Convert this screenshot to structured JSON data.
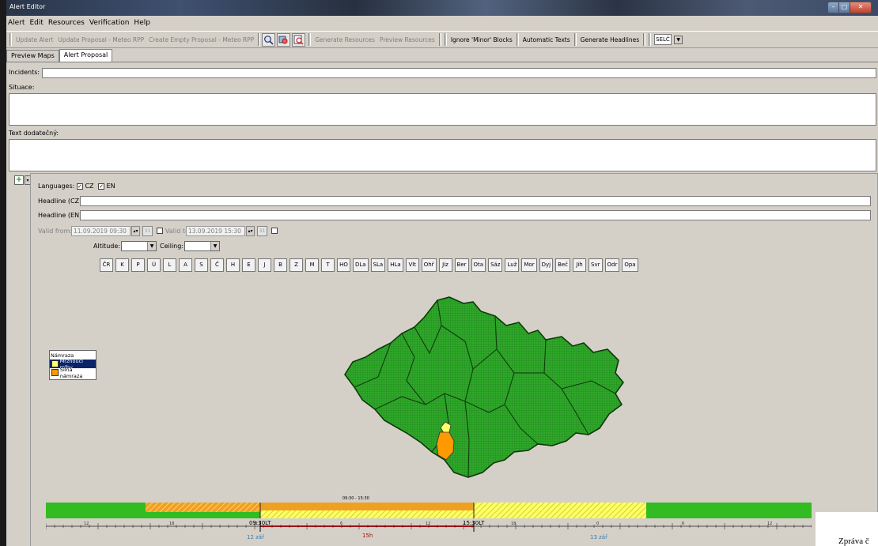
{
  "window": {
    "title": "Alert Editor"
  },
  "menu": [
    "Alert",
    "Edit",
    "Resources",
    "Verification",
    "Help"
  ],
  "toolbar": {
    "update_alert": "Update Alert",
    "update_proposal": "Update Proposal - Meteo RPP",
    "create_empty": "Create Empty Proposal - Meteo RPP",
    "generate_resources": "Generate Resources",
    "preview_resources": "Preview Resources",
    "ignore_minor": "Ignore 'Minor' Blocks",
    "automatic_texts": "Automatic Texts",
    "generate_headlines": "Generate Headlines",
    "station_value": "SELČ"
  },
  "tabs": [
    "Preview Maps",
    "Alert Proposal"
  ],
  "form": {
    "incidents_label": "Incidents:",
    "situace_label": "Situace:",
    "text_label": "Text dodatečný:",
    "languages_label": "Languages:",
    "lang_cz": "CZ",
    "lang_en": "EN",
    "headline_cz_label": "Headline (CZ):",
    "headline_en_label": "Headline (EN):",
    "valid_from_label": "Valid from:",
    "valid_from_value": "11.09.2019 09:30",
    "valid_to_label": "Valid to:",
    "valid_to_value": "13.09.2019 15:30",
    "altitude_label": "Altitude:",
    "ceiling_label": "Ceiling:"
  },
  "regions": [
    "ČR",
    "K",
    "P",
    "Ú",
    "L",
    "A",
    "S",
    "Č",
    "H",
    "E",
    "J",
    "B",
    "Z",
    "M",
    "T",
    "HO",
    "DLa",
    "SLa",
    "HLa",
    "Vlt",
    "Ohř",
    "Jiz",
    "Ber",
    "Ota",
    "Sáz",
    "Luž",
    "Mor",
    "Dyj",
    "Beč",
    "Jih",
    "Svr",
    "Odr",
    "Opa"
  ],
  "legend": {
    "title": "Námraza",
    "items": [
      {
        "label": "Mrznoucí mlhy",
        "color": "#ffff66"
      },
      {
        "label": "Silná námraza",
        "color": "#ff9900"
      }
    ]
  },
  "timeline": {
    "range_label": "09:30 - 15:30",
    "start_label": "09:30LT",
    "end_label": "15:30LT",
    "duration_label": "15h",
    "date_start": "12 zář",
    "date_end": "13 zář",
    "hour_ticks": [
      "12",
      "18",
      "0",
      "6",
      "12",
      "18",
      "0",
      "6",
      "12"
    ]
  },
  "footer_text": "Zpráva č",
  "colors": {
    "green": "#33aa22",
    "orange": "#f0a020",
    "yellow": "#ffff66",
    "panel": "#d4d0c8"
  }
}
